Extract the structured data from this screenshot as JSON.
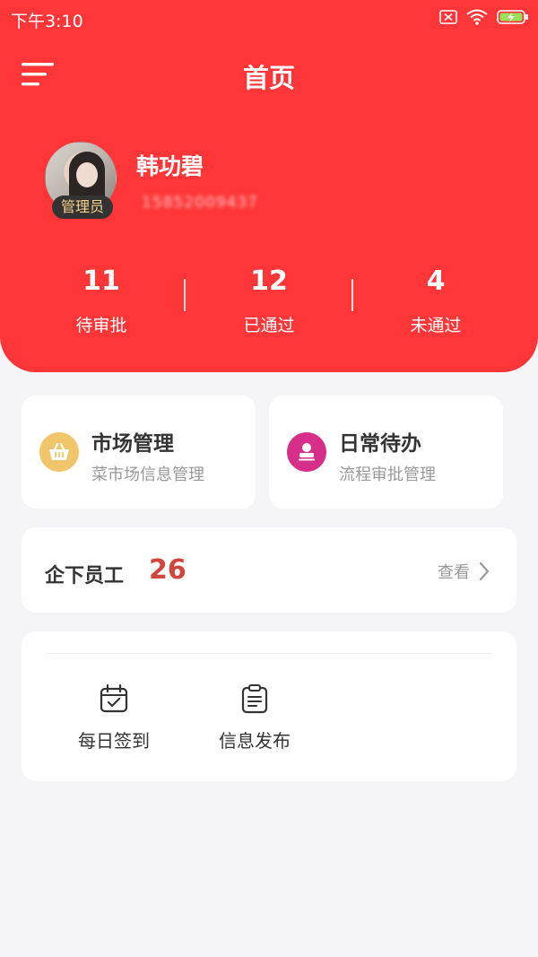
{
  "status_bar": {
    "time": "下午3:10"
  },
  "header": {
    "title": "首页"
  },
  "user": {
    "name": "韩功碧",
    "phone": "15852009437",
    "role": "管理员"
  },
  "stats": [
    {
      "value": "11",
      "label": "待审批"
    },
    {
      "value": "12",
      "label": "已通过"
    },
    {
      "value": "4",
      "label": "未通过"
    }
  ],
  "quick_actions": [
    {
      "title": "市场管理",
      "subtitle": "菜市场信息管理",
      "icon": "basket-icon",
      "color": "#f1c66a"
    },
    {
      "title": "日常待办",
      "subtitle": "流程审批管理",
      "icon": "stamp-icon",
      "color": "#d62f8a"
    }
  ],
  "employees": {
    "label": "企下员工",
    "count": "26",
    "link": "查看"
  },
  "tools": [
    {
      "label": "每日签到",
      "icon": "calendar-check-icon"
    },
    {
      "label": "信息发布",
      "icon": "clipboard-icon"
    }
  ],
  "colors": {
    "primary": "#ff3638",
    "accent_count": "#d1463c",
    "background": "#f5f4f7"
  }
}
